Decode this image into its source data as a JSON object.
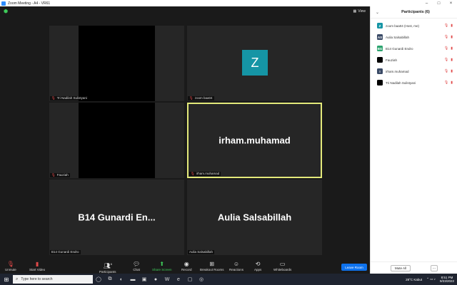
{
  "window": {
    "title": "Zoom Meeting - A4 - VR61",
    "controls": [
      "–",
      "□",
      "×"
    ]
  },
  "header": {
    "view_label": "View"
  },
  "tiles": [
    {
      "name": "Tri Nadilah Sulistyani",
      "display": "video-black",
      "muted": true
    },
    {
      "name": "zoom baa04",
      "display": "avatar",
      "avatar_letter": "Z",
      "avatar_color": "#1595A5",
      "muted": true
    },
    {
      "name": "Fauziah",
      "display": "video-black",
      "muted": true
    },
    {
      "name": "irham.muhamad",
      "display": "name",
      "big_name": "irham.muhamad",
      "active": true,
      "muted": true
    },
    {
      "name": "B14 Gunardi Endro",
      "display": "name",
      "big_name": "B14 Gunardi En...",
      "muted": false
    },
    {
      "name": "Aulia Salsabillah",
      "display": "name",
      "big_name": "Aulia Salsabillah",
      "muted": false
    }
  ],
  "toolbar": {
    "unmute": "Unmute",
    "start_video": "Start Video",
    "participants": "Participants",
    "participants_count": "6",
    "chat": "Chat",
    "share_screen": "Share Screen",
    "record": "Record",
    "breakout_rooms": "Breakout Rooms",
    "reactions": "Reactions",
    "apps": "Apps",
    "whiteboards": "Whiteboards",
    "leave": "Leave Room"
  },
  "participants_panel": {
    "title": "Participants (6)",
    "items": [
      {
        "initials": "Z",
        "color": "#1595A5",
        "name": "zoom baa04 (Host, me)"
      },
      {
        "initials": "AS",
        "color": "#3A4A66",
        "name": "Aulia Salsabillah"
      },
      {
        "initials": "BG",
        "color": "#2BA36E",
        "name": "B14 Gunardi Endro"
      },
      {
        "initials": "",
        "color": "#000000",
        "name": "Fauziah"
      },
      {
        "initials": "I",
        "color": "#3A4A66",
        "name": "irham.muhamad"
      },
      {
        "initials": "",
        "color": "#000000",
        "name": "Tri Nadilah Sulistyani"
      }
    ],
    "mute_all": "Mute All",
    "more": "···"
  },
  "taskbar": {
    "search_placeholder": "Type here to search",
    "weather": "28°C  Kabut",
    "time": "8:51 PM",
    "date": "9/23/2022"
  }
}
